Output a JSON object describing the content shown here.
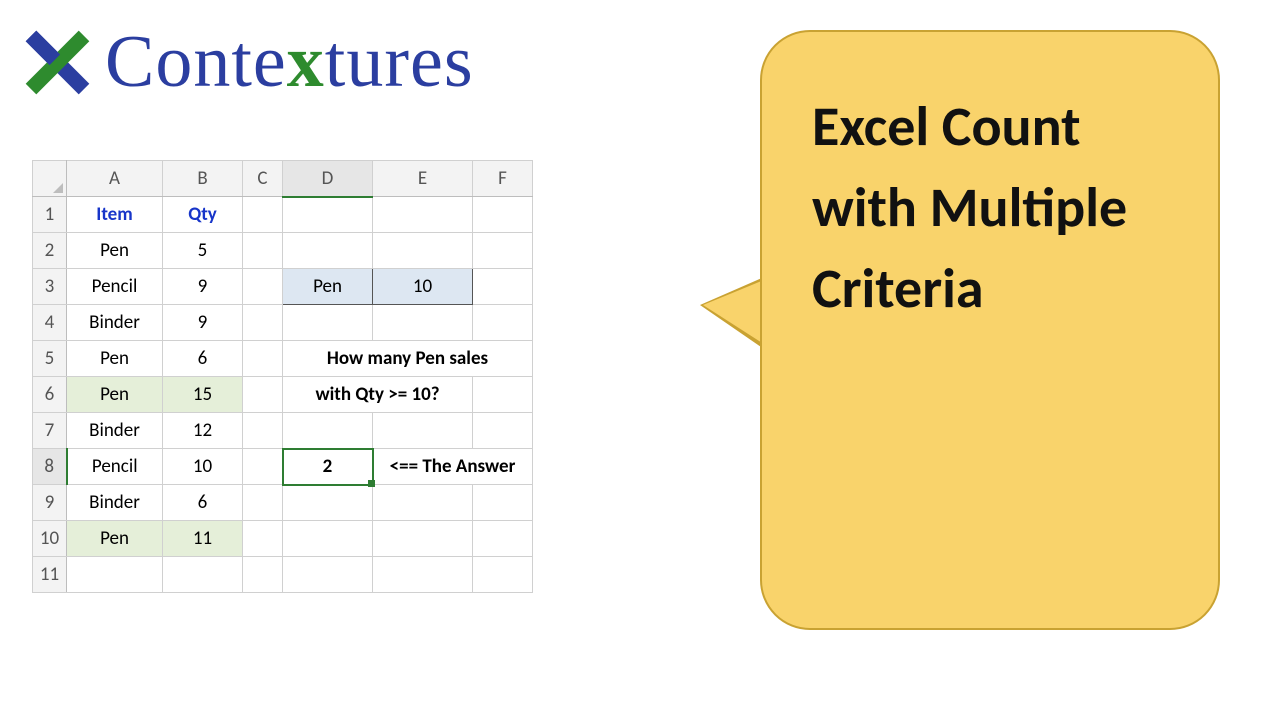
{
  "brand": {
    "name_pre": "Conte",
    "name_x": "x",
    "name_post": "tures"
  },
  "columns": [
    "A",
    "B",
    "C",
    "D",
    "E",
    "F"
  ],
  "rows": [
    "1",
    "2",
    "3",
    "4",
    "5",
    "6",
    "7",
    "8",
    "9",
    "10",
    "11"
  ],
  "table": {
    "header_item": "Item",
    "header_qty": "Qty",
    "data": [
      {
        "item": "Pen",
        "qty": "5",
        "hl": false
      },
      {
        "item": "Pencil",
        "qty": "9",
        "hl": false
      },
      {
        "item": "Binder",
        "qty": "9",
        "hl": false
      },
      {
        "item": "Pen",
        "qty": "6",
        "hl": false
      },
      {
        "item": "Pen",
        "qty": "15",
        "hl": true
      },
      {
        "item": "Binder",
        "qty": "12",
        "hl": false
      },
      {
        "item": "Pencil",
        "qty": "10",
        "hl": false
      },
      {
        "item": "Binder",
        "qty": "6",
        "hl": false
      },
      {
        "item": "Pen",
        "qty": "11",
        "hl": true
      }
    ]
  },
  "criteria": {
    "item": "Pen",
    "qty": "10"
  },
  "question_line1": "How many Pen sales",
  "question_line2": "with Qty >= 10?",
  "answer_value": "2",
  "answer_label": "<== The Answer",
  "callout_text": "Excel Count with Multiple Criteria",
  "colors": {
    "brand_blue": "#2b3ea0",
    "brand_green": "#2e8b2e",
    "highlight_green": "#e5efd9",
    "criteria_blue": "#dde7f2",
    "select_green": "#2e7d32",
    "callout_fill": "#f9d36b",
    "callout_stroke": "#c9a232"
  }
}
